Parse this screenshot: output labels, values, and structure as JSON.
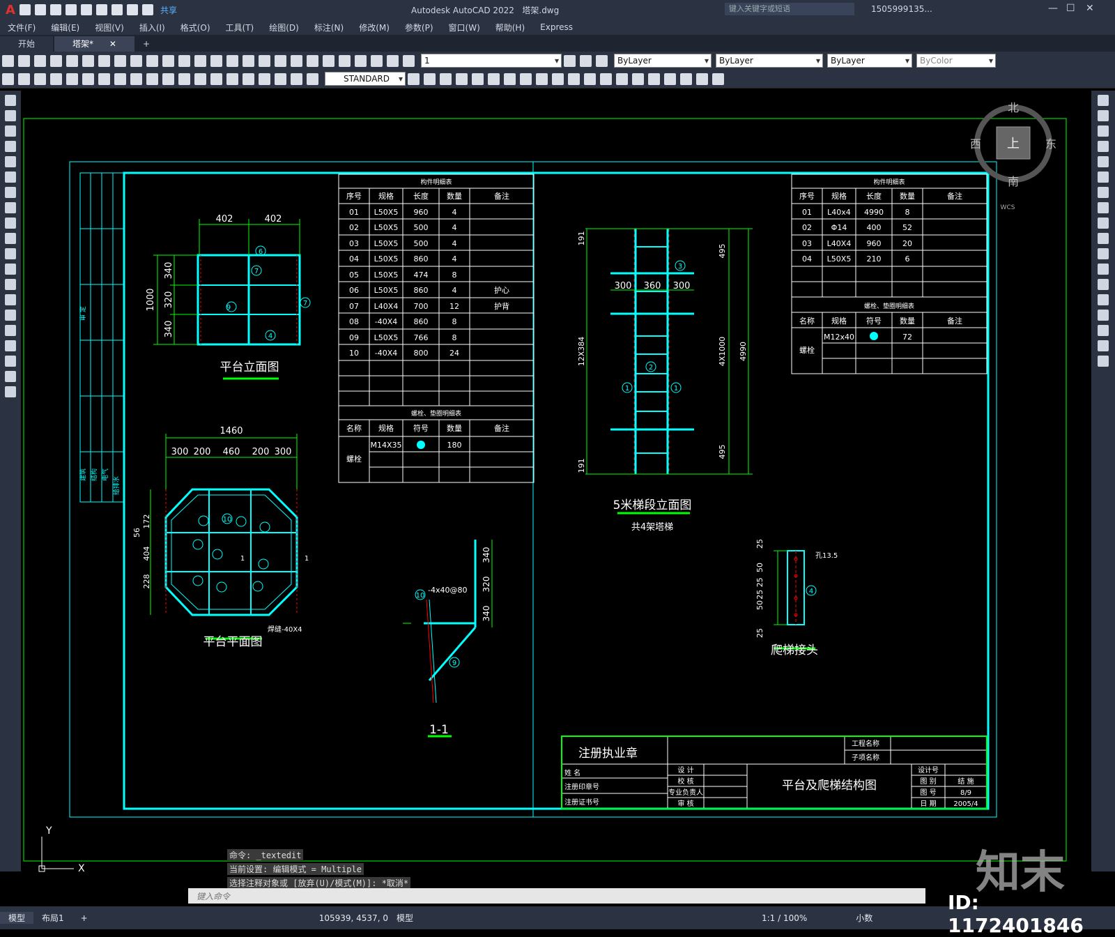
{
  "titlebar": {
    "app_title": "Autodesk AutoCAD 2022",
    "filename": "塔架.dwg",
    "share": "共享",
    "search_placeholder": "键入关键字或短语",
    "user": "1505999135...",
    "menu_glyph": "A"
  },
  "menus": [
    "文件(F)",
    "编辑(E)",
    "视图(V)",
    "插入(I)",
    "格式(O)",
    "工具(T)",
    "绘图(D)",
    "标注(N)",
    "修改(M)",
    "参数(P)",
    "窗口(W)",
    "帮助(H)",
    "Express"
  ],
  "tabs": [
    {
      "label": "开始"
    },
    {
      "label": "塔架*"
    }
  ],
  "toolbar": {
    "layer": "1",
    "color": "ByLayer",
    "linetype": "ByLayer",
    "lineweight": "ByLayer",
    "plotstyle": "ByColor",
    "textstyle": "STANDARD"
  },
  "viewcube": {
    "north": "北",
    "south": "南",
    "east": "东",
    "west": "西",
    "top": "上",
    "wcs": "WCS"
  },
  "drawing": {
    "table1_title": "构件明细表",
    "table1_headers": [
      "序号",
      "规格",
      "长度",
      "数量",
      "备注"
    ],
    "table1_rows": [
      [
        "01",
        "L50X5",
        "960",
        "4",
        ""
      ],
      [
        "02",
        "L50X5",
        "500",
        "4",
        ""
      ],
      [
        "03",
        "L50X5",
        "500",
        "4",
        ""
      ],
      [
        "04",
        "L50X5",
        "860",
        "4",
        ""
      ],
      [
        "05",
        "L50X5",
        "474",
        "8",
        ""
      ],
      [
        "06",
        "L50X5",
        "860",
        "4",
        "护心"
      ],
      [
        "07",
        "L40X4",
        "700",
        "12",
        "护背"
      ],
      [
        "08",
        "-40X4",
        "860",
        "8",
        ""
      ],
      [
        "09",
        "L50X5",
        "766",
        "8",
        ""
      ],
      [
        "10",
        "-40X4",
        "800",
        "24",
        ""
      ]
    ],
    "bolt1_title": "螺栓、垫圈明细表",
    "bolt1_headers": [
      "名称",
      "规格",
      "符号",
      "数量",
      "备注"
    ],
    "bolt1_row": [
      "螺栓",
      "M14X35",
      "",
      "180",
      ""
    ],
    "table2_title": "构件明细表",
    "table2_headers": [
      "序号",
      "规格",
      "长度",
      "数量",
      "备注"
    ],
    "table2_rows": [
      [
        "01",
        "L40x4",
        "4990",
        "8",
        ""
      ],
      [
        "02",
        "Φ14",
        "400",
        "52",
        ""
      ],
      [
        "03",
        "L40X4",
        "960",
        "20",
        ""
      ],
      [
        "04",
        "L50X5",
        "210",
        "6",
        ""
      ]
    ],
    "bolt2_title": "螺栓、垫圈明细表",
    "bolt2_headers": [
      "名称",
      "规格",
      "符号",
      "数量",
      "备注"
    ],
    "bolt2_row": [
      "螺栓",
      "M12x40",
      "",
      "72",
      ""
    ],
    "view_elev": "平台立面图",
    "view_plan": "平台平面图",
    "view_section": "1-1",
    "view_ladder": "5米梯段立面图",
    "view_ladder_note": "共4架塔梯",
    "view_joint": "爬梯接头",
    "dims_elev": {
      "w1": "402",
      "w2": "402",
      "h": "1000",
      "h1": "340",
      "h2": "320",
      "h3": "340"
    },
    "dims_plan": {
      "total": "1460",
      "a": "300",
      "b": "200",
      "c": "460",
      "d": "200",
      "e": "300",
      "v1": "172",
      "v2": "56",
      "v3": "404",
      "v4": "228",
      "weld": "焊缝-40X4"
    },
    "dims_section": {
      "plate": "-4x40@80",
      "a": "340",
      "b": "320",
      "c": "340"
    },
    "dims_ladder": {
      "top": "191",
      "bot": "191",
      "w1": "300",
      "w2": "360",
      "w3": "300",
      "h": "12X384",
      "r1": "495",
      "r2": "4X1000",
      "r3": "495",
      "total": "4990"
    },
    "dims_joint": {
      "hole": "孔13.5",
      "a": "25",
      "b": "50",
      "c": "25 25",
      "d": "10",
      "e": "50",
      "f": "25"
    },
    "markers": [
      "1",
      "2",
      "3",
      "4",
      "6",
      "7",
      "8",
      "9",
      "10"
    ],
    "side_labels": [
      "建筑",
      "结构",
      "电气",
      "给排水",
      "审 定"
    ],
    "titleblock": {
      "seal": "注册执业章",
      "project": "工程名称",
      "subproject": "子项名称",
      "name": "姓 名",
      "stamp": "注册印章号",
      "cert": "注册证书号",
      "design": "设 计",
      "check": "校 核",
      "lead": "专业负责人",
      "review": "审 核",
      "drawing_title": "平台及爬梯结构图",
      "num_label": "设计号",
      "cat_label": "图 别",
      "cat": "结 施",
      "no_label": "图 号",
      "no": "8/9",
      "date_label": "日 期",
      "date": "2005/4"
    }
  },
  "commands": [
    "命令: _textedit",
    "当前设置: 编辑模式 = Multiple",
    "选择注释对象或 [放弃(U)/模式(M)]: *取消*"
  ],
  "command_placeholder": "键入命令",
  "status": {
    "model_tab": "模型",
    "layout_tab": "布局1",
    "coords": "105939, 4537, 0",
    "mode": "模型",
    "scale": "1:1 / 100%",
    "units": "小数"
  },
  "watermark": {
    "brand": "知末",
    "id": "ID: 1172401846"
  },
  "colors": {
    "cyan": "#00ffff",
    "green": "#00ff00",
    "red": "#ff0000",
    "dark": "#2b3342"
  }
}
